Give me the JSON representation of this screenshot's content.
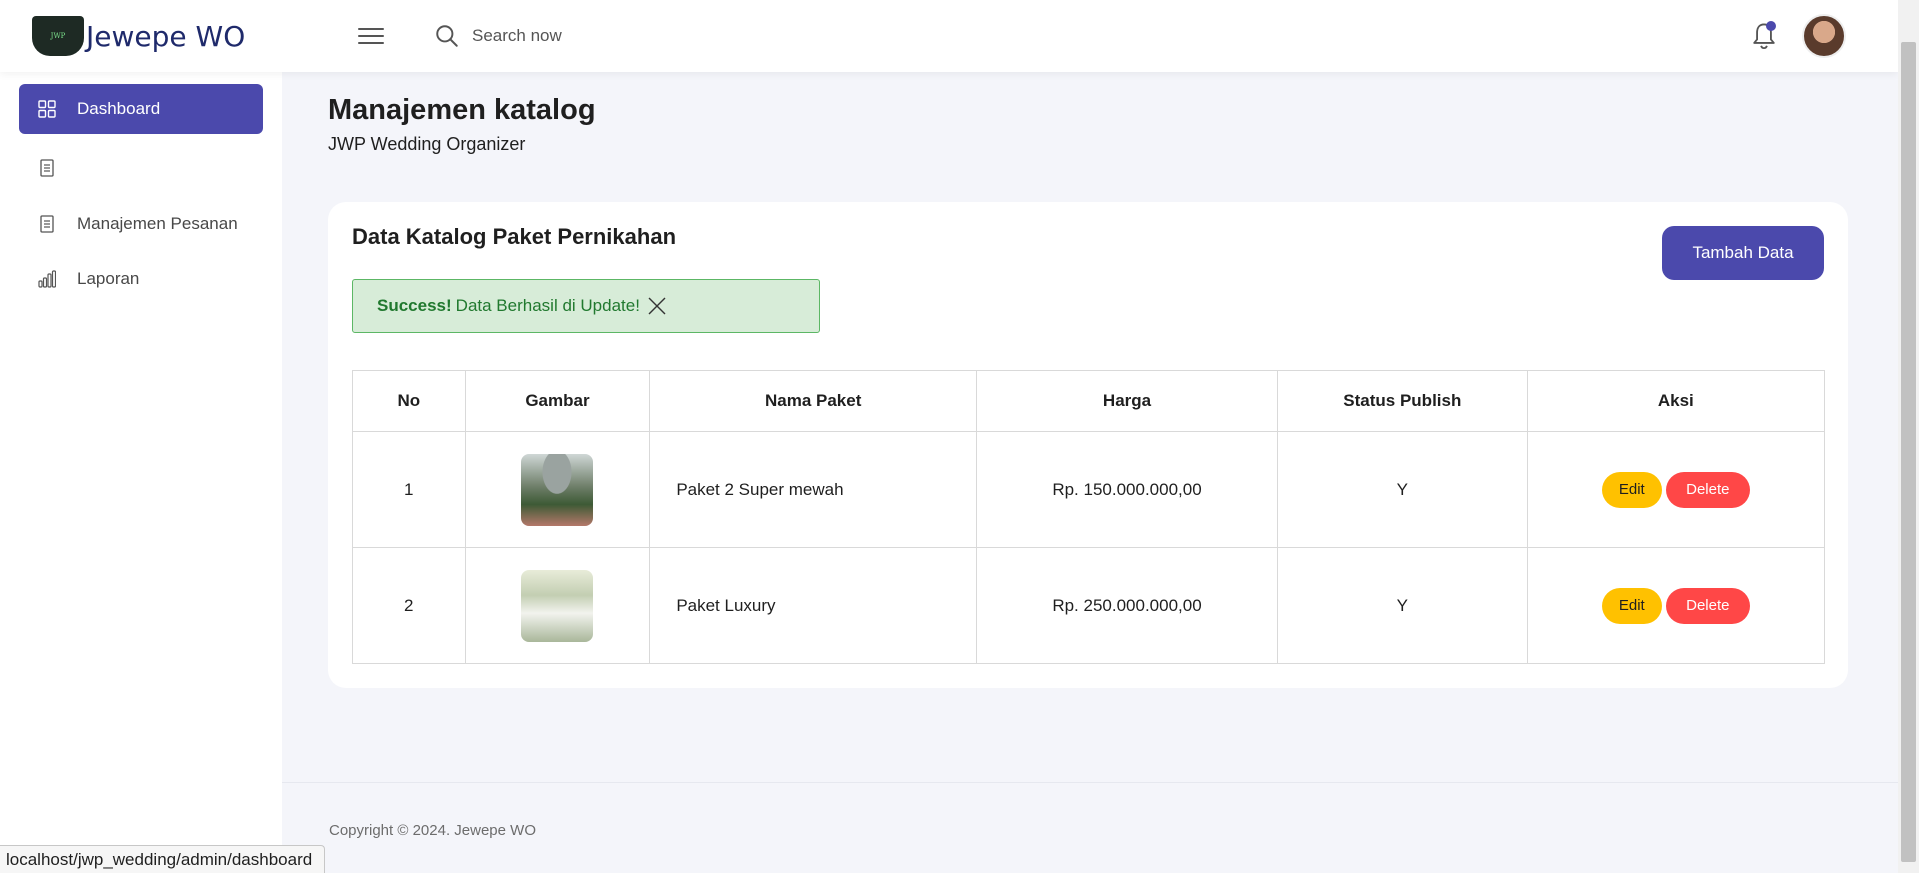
{
  "brand": {
    "name": "Jewepe WO",
    "logo_text": "JWP"
  },
  "header": {
    "search_placeholder": "Search now"
  },
  "sidebar": {
    "items": [
      {
        "label": "Dashboard",
        "icon": "grid-icon"
      },
      {
        "label": "",
        "icon": "document-icon"
      },
      {
        "label": "Manajemen Pesanan",
        "icon": "document-icon"
      },
      {
        "label": "Laporan",
        "icon": "bar-chart-icon"
      }
    ]
  },
  "page": {
    "title": "Manajemen katalog",
    "subtitle": "JWP Wedding Organizer"
  },
  "card": {
    "title": "Data Katalog Paket Pernikahan",
    "add_button": "Tambah Data",
    "alert": {
      "strong": "Success!",
      "message": "Data Berhasil di Update!"
    },
    "table": {
      "headers": [
        "No",
        "Gambar",
        "Nama Paket",
        "Harga",
        "Status Publish",
        "Aksi"
      ],
      "rows": [
        {
          "no": "1",
          "name": "Paket 2 Super mewah",
          "price": "Rp. 150.000.000,00",
          "status": "Y",
          "edit": "Edit",
          "delete": "Delete"
        },
        {
          "no": "2",
          "name": "Paket Luxury",
          "price": "Rp. 250.000.000,00",
          "status": "Y",
          "edit": "Edit",
          "delete": "Delete"
        }
      ]
    }
  },
  "footer": {
    "copyright": "Copyright © 2024. Jewepe WO"
  },
  "status_bar": {
    "url": "localhost/jwp_wedding/admin/dashboard"
  },
  "colors": {
    "primary": "#4b49ac",
    "edit": "#ffc100",
    "delete": "#ff4747",
    "success_bg": "#d7ecd8",
    "success_text": "#21792f"
  }
}
